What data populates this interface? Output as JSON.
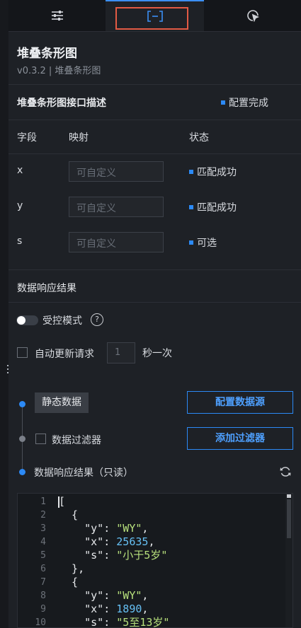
{
  "tabs": [
    {
      "name": "settings",
      "icon": "sliders-icon"
    },
    {
      "name": "data",
      "icon": "bracket-minus-icon",
      "active": true
    },
    {
      "name": "interaction",
      "icon": "cursor-click-icon"
    }
  ],
  "component": {
    "title": "堆叠条形图",
    "version": "v0.3.2 | 堆叠条形图"
  },
  "interface": {
    "title": "堆叠条形图接口描述",
    "status": "配置完成",
    "columns": [
      "字段",
      "映射",
      "状态"
    ],
    "rows": [
      {
        "field": "x",
        "placeholder": "可自定义",
        "status": "匹配成功"
      },
      {
        "field": "y",
        "placeholder": "可自定义",
        "status": "匹配成功"
      },
      {
        "field": "s",
        "placeholder": "可自定义",
        "status": "可选"
      }
    ]
  },
  "response": {
    "header": "数据响应结果",
    "controlled_mode_label": "受控模式",
    "help": "?",
    "auto_update_label": "自动更新请求",
    "interval_value": "1",
    "interval_unit": "秒一次"
  },
  "pipeline": {
    "static_data": "静态数据",
    "config_source_btn": "配置数据源",
    "filter_label": "数据过滤器",
    "add_filter_btn": "添加过滤器",
    "result_label": "数据响应结果（只读）"
  },
  "code_editor": {
    "line_numbers": [
      "1",
      "2",
      "3",
      "4",
      "5",
      "6",
      "7",
      "8",
      "9",
      "10"
    ],
    "lines": [
      {
        "indent": "",
        "text": "["
      },
      {
        "indent": "  ",
        "text": "{"
      },
      {
        "indent": "    ",
        "key": "\"y\"",
        "value": "\"WY\"",
        "type": "s",
        "trail": ","
      },
      {
        "indent": "    ",
        "key": "\"x\"",
        "value": "25635",
        "type": "n",
        "trail": ","
      },
      {
        "indent": "    ",
        "key": "\"s\"",
        "value": "\"小于5岁\"",
        "type": "s",
        "trail": ""
      },
      {
        "indent": "  ",
        "text": "},"
      },
      {
        "indent": "  ",
        "text": "{"
      },
      {
        "indent": "    ",
        "key": "\"y\"",
        "value": "\"WY\"",
        "type": "s",
        "trail": ","
      },
      {
        "indent": "    ",
        "key": "\"x\"",
        "value": "1890",
        "type": "n",
        "trail": ","
      },
      {
        "indent": "    ",
        "key": "\"s\"",
        "value": "\"5至13岁\"",
        "type": "s",
        "trail": ""
      }
    ]
  },
  "colors": {
    "accent": "#2c8af6",
    "highlight": "#e25a44",
    "string": "#b7e07c",
    "number": "#66c0f4"
  }
}
